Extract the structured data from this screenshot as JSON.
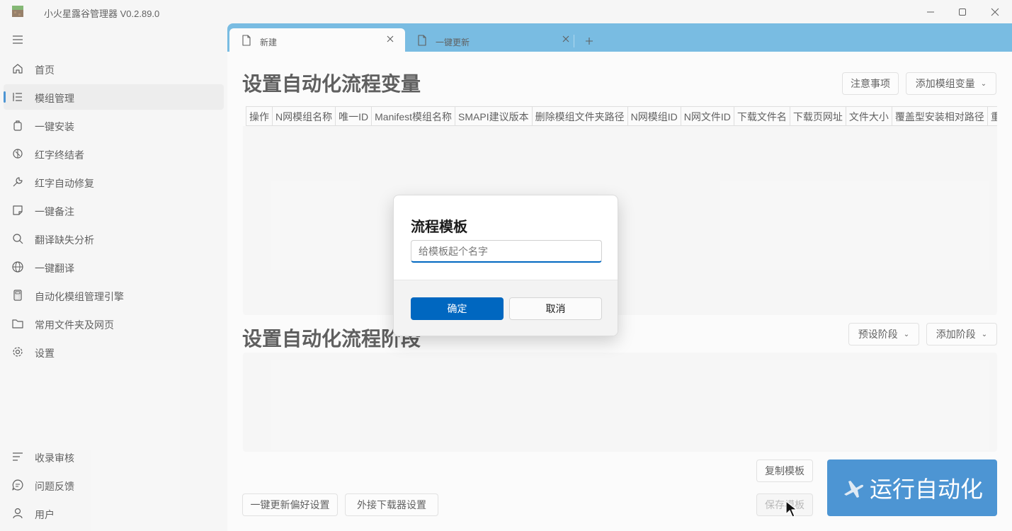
{
  "app": {
    "title": "小火星露谷管理器 V0.2.89.0"
  },
  "window_controls": [
    "minimize",
    "maximize",
    "close"
  ],
  "sidebar": {
    "items": [
      {
        "label": "首页",
        "icon": "home-icon"
      },
      {
        "label": "模组管理",
        "icon": "list-icon",
        "active": true
      },
      {
        "label": "一键安装",
        "icon": "bag-icon"
      },
      {
        "label": "红字终结者",
        "icon": "bug-icon"
      },
      {
        "label": "红字自动修复",
        "icon": "wrench-icon"
      },
      {
        "label": "一键备注",
        "icon": "note-icon"
      },
      {
        "label": "翻译缺失分析",
        "icon": "search-icon"
      },
      {
        "label": "一键翻译",
        "icon": "globe-icon"
      },
      {
        "label": "自动化模组管理引擎",
        "icon": "calculator-icon"
      },
      {
        "label": "常用文件夹及网页",
        "icon": "folder-icon"
      },
      {
        "label": "设置",
        "icon": "gear-icon"
      }
    ],
    "footer_items": [
      {
        "label": "收录审核",
        "icon": "list-icon"
      },
      {
        "label": "问题反馈",
        "icon": "chat-icon"
      },
      {
        "label": "用户",
        "icon": "user-icon"
      }
    ]
  },
  "tabs": [
    {
      "label": "新建",
      "active": true
    },
    {
      "label": "一键更新",
      "active": false
    }
  ],
  "variables_section": {
    "title": "设置自动化流程变量",
    "notes_button": "注意事项",
    "add_variable_button": "添加模组变量",
    "columns": [
      "操作",
      "N网模组名称",
      "唯一ID",
      "Manifest模组名称",
      "SMAPI建议版本",
      "删除模组文件夹路径",
      "N网模组ID",
      "N网文件ID",
      "下载文件名",
      "下载页网址",
      "文件大小",
      "覆盖型安装相对路径",
      "重"
    ]
  },
  "stages_section": {
    "title": "设置自动化流程阶段",
    "preset_button": "预设阶段",
    "add_stage_button": "添加阶段"
  },
  "footer": {
    "update_prefs_button": "一键更新偏好设置",
    "downloader_button": "外接下载器设置",
    "copy_template_button": "复制模板",
    "save_template_button": "保存模板",
    "run_button": "运行自动化"
  },
  "dialog": {
    "title": "流程模板",
    "input_placeholder": "给模板起个名字",
    "input_value": "",
    "confirm": "确定",
    "cancel": "取消"
  },
  "colors": {
    "accent": "#0067c0",
    "tabstrip": "#3fa0d6"
  }
}
